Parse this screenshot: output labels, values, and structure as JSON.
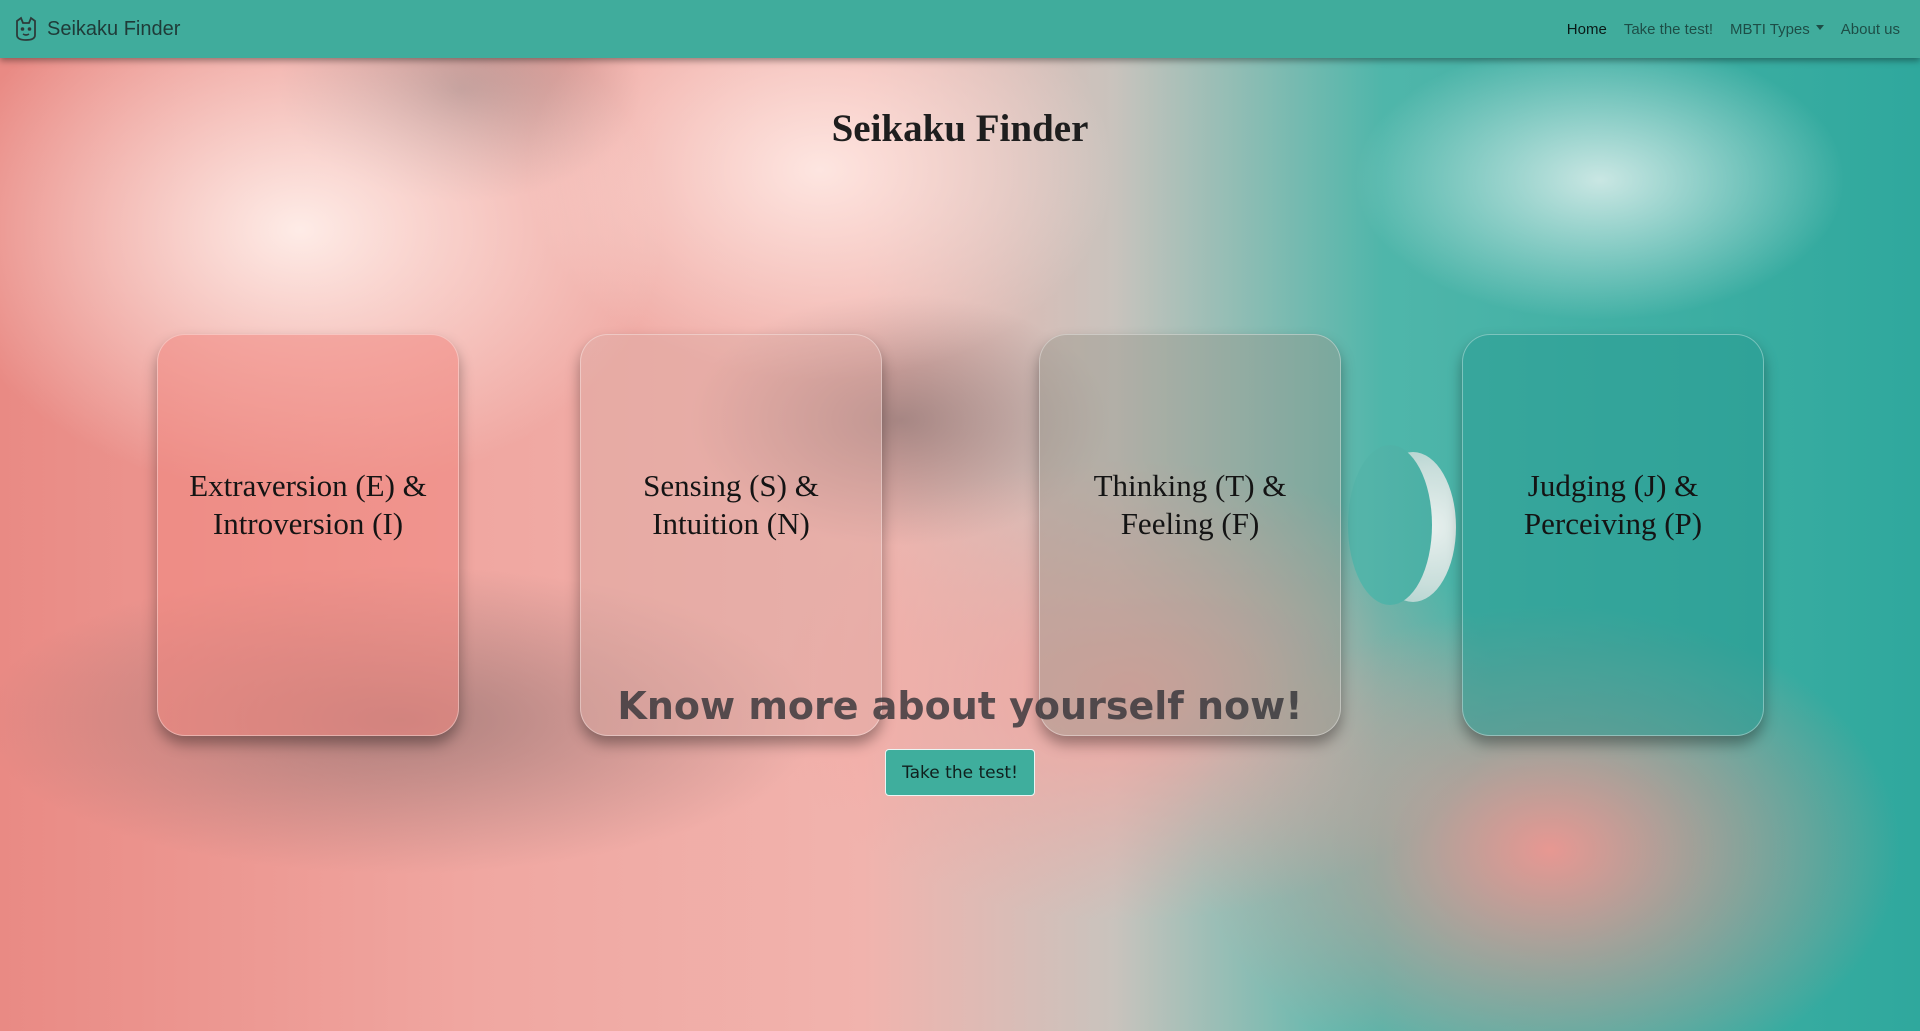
{
  "navbar": {
    "brand": "Seikaku Finder",
    "brand_icon": "mascot-icon",
    "links": [
      {
        "label": "Home",
        "active": true
      },
      {
        "label": "Take the test!",
        "active": false
      },
      {
        "label": "MBTI Types",
        "active": false,
        "dropdown": true
      },
      {
        "label": "About us",
        "active": false
      }
    ]
  },
  "main": {
    "title": "Seikaku Finder",
    "cards": [
      {
        "label": "Extraversion (E) & Introversion (I)"
      },
      {
        "label": "Sensing (S) & Intuition (N)"
      },
      {
        "label": "Thinking (T) & Feeling (F)"
      },
      {
        "label": "Judging (J) & Perceiving (P)"
      }
    ],
    "tagline": "Know more about yourself now!",
    "cta_label": "Take the test!"
  },
  "colors": {
    "navbar": "#40ac9c",
    "accent": "#3fae9d"
  }
}
